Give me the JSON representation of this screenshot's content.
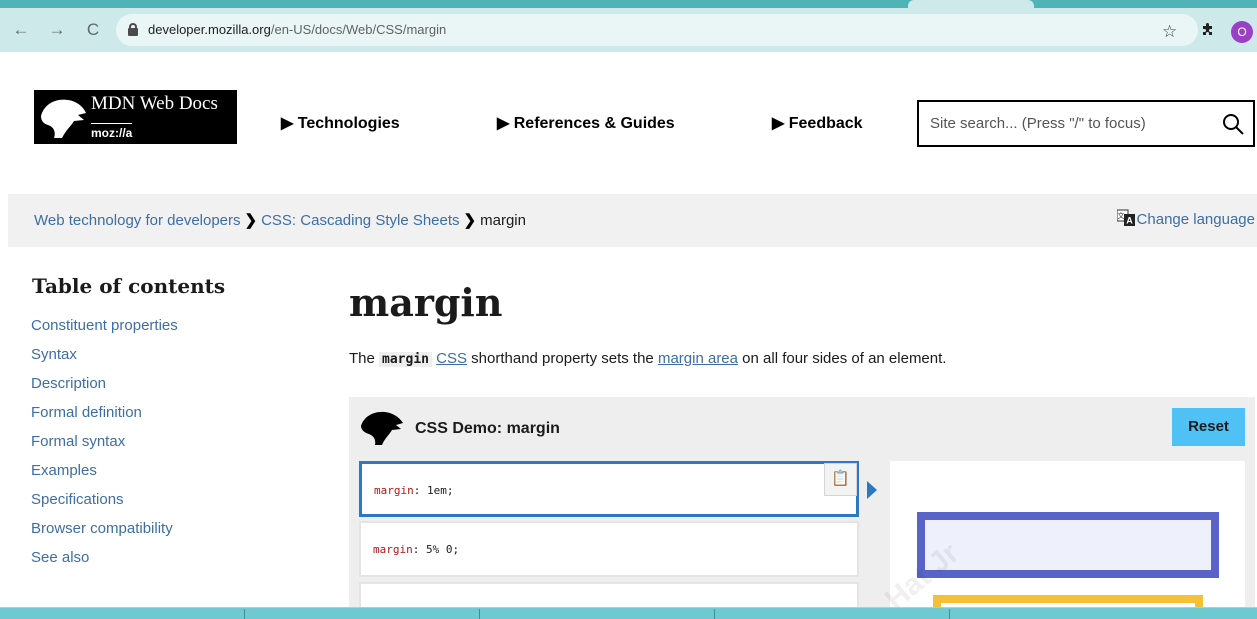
{
  "browser": {
    "url_host": "developer.mozilla.org",
    "url_path": "/en-US/docs/Web/CSS/margin",
    "profile_initial": "O"
  },
  "header": {
    "logo_title": "MDN Web Docs",
    "logo_sub": "moz://a",
    "nav": [
      {
        "label": "Technologies"
      },
      {
        "label": "References & Guides"
      },
      {
        "label": "Feedback"
      }
    ],
    "search_placeholder": "Site search... (Press \"/\" to focus)"
  },
  "breadcrumb": {
    "items": [
      "Web technology for developers",
      "CSS: Cascading Style Sheets"
    ],
    "current": "margin",
    "change_language": "Change language"
  },
  "toc": {
    "title": "Table of contents",
    "items": [
      "Constituent properties",
      "Syntax",
      "Description",
      "Formal definition",
      "Formal syntax",
      "Examples",
      "Specifications",
      "Browser compatibility",
      "See also"
    ]
  },
  "article": {
    "title": "margin",
    "intro_pre": "The ",
    "intro_code": "margin",
    "intro_link1": "CSS",
    "intro_mid": " shorthand property sets the ",
    "intro_link2": "margin area",
    "intro_post": " on all four sides of an element."
  },
  "demo": {
    "title": "CSS Demo: margin",
    "reset_label": "Reset",
    "examples": [
      {
        "prop": "margin",
        "value": " 1em;"
      },
      {
        "prop": "margin",
        "value": " 5% 0;"
      }
    ],
    "copy_icon_glyph": "📋",
    "colors": {
      "selected_border": "#2b79c2",
      "box_border": "#5a64c8",
      "box2_border": "#f5bf36",
      "reset_bg": "#4fc1f5"
    }
  },
  "watermark": "Hat Jr"
}
